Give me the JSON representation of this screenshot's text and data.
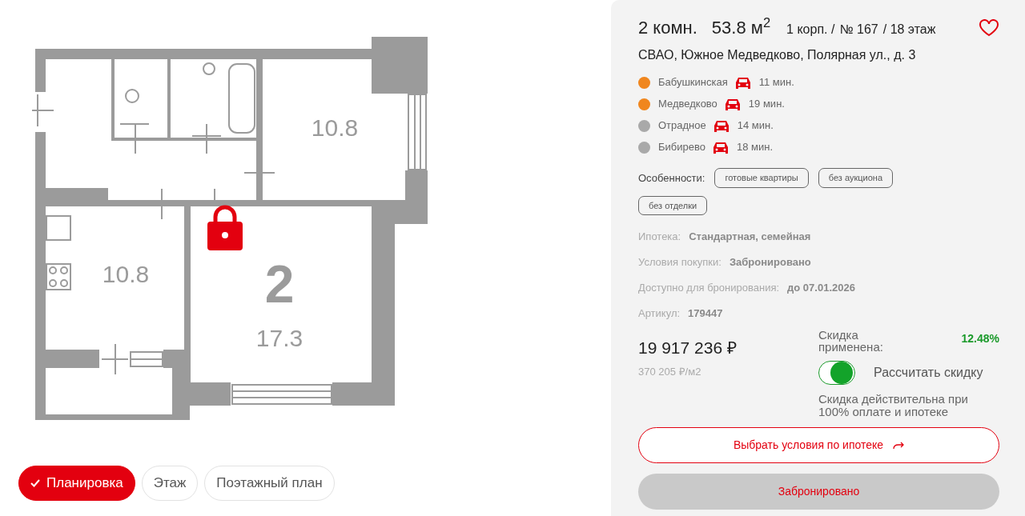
{
  "plan": {
    "rooms": [
      {
        "kind": "area",
        "label": "10.8"
      },
      {
        "kind": "area",
        "label": "10.8"
      },
      {
        "kind": "count",
        "label": "2"
      },
      {
        "kind": "area",
        "label": "17.3"
      }
    ],
    "locked": true
  },
  "view_tabs": [
    {
      "label": "Планировка",
      "selected": true
    },
    {
      "label": "Этаж",
      "selected": false
    },
    {
      "label": "Поэтажный план",
      "selected": false
    }
  ],
  "header": {
    "rooms": "2 комн.",
    "area": "53.8 м$^{2}$",
    "building": "1 корп. /",
    "number": "№ 167",
    "floor": "/ 18 этаж",
    "favorite": false
  },
  "address": "СВАО, Южное Медведково, Полярная ул., д. 3",
  "metro": [
    {
      "name": "Бабушкинская",
      "color": "#f0861e",
      "time": "11 мин."
    },
    {
      "name": "Медведково",
      "color": "#f0861e",
      "time": "19 мин."
    },
    {
      "name": "Отрадное",
      "color": "#a9a9a9",
      "time": "14 мин."
    },
    {
      "name": "Бибирево",
      "color": "#a9a9a9",
      "time": "18 мин."
    }
  ],
  "features": {
    "label": "Особенности:",
    "tags": [
      "готовые квартиры",
      "без аукциона",
      "без отделки"
    ]
  },
  "info": [
    {
      "label": "Ипотека:",
      "value": "Стандартная, семейная"
    },
    {
      "label": "Условия покупки:",
      "value": "Забронировано"
    },
    {
      "label": "Доступно для бронирования:",
      "value": "до 07.01.2026"
    },
    {
      "label": "Артикул:",
      "value": "179447"
    }
  ],
  "price": {
    "total": "19 917 236 ₽",
    "per_m2": "370 205 ₽/м2"
  },
  "discount": {
    "label": "Скидка применена:",
    "value": "12.48%",
    "toggle_label": "Рассчитать скидку",
    "on": true,
    "note": "Скидка действительна при 100% оплате и ипотеке"
  },
  "buttons": [
    {
      "kind": "outline",
      "label": "Выбрать условия по ипотеке"
    },
    {
      "kind": "disabled",
      "label": "Забронировано"
    }
  ]
}
